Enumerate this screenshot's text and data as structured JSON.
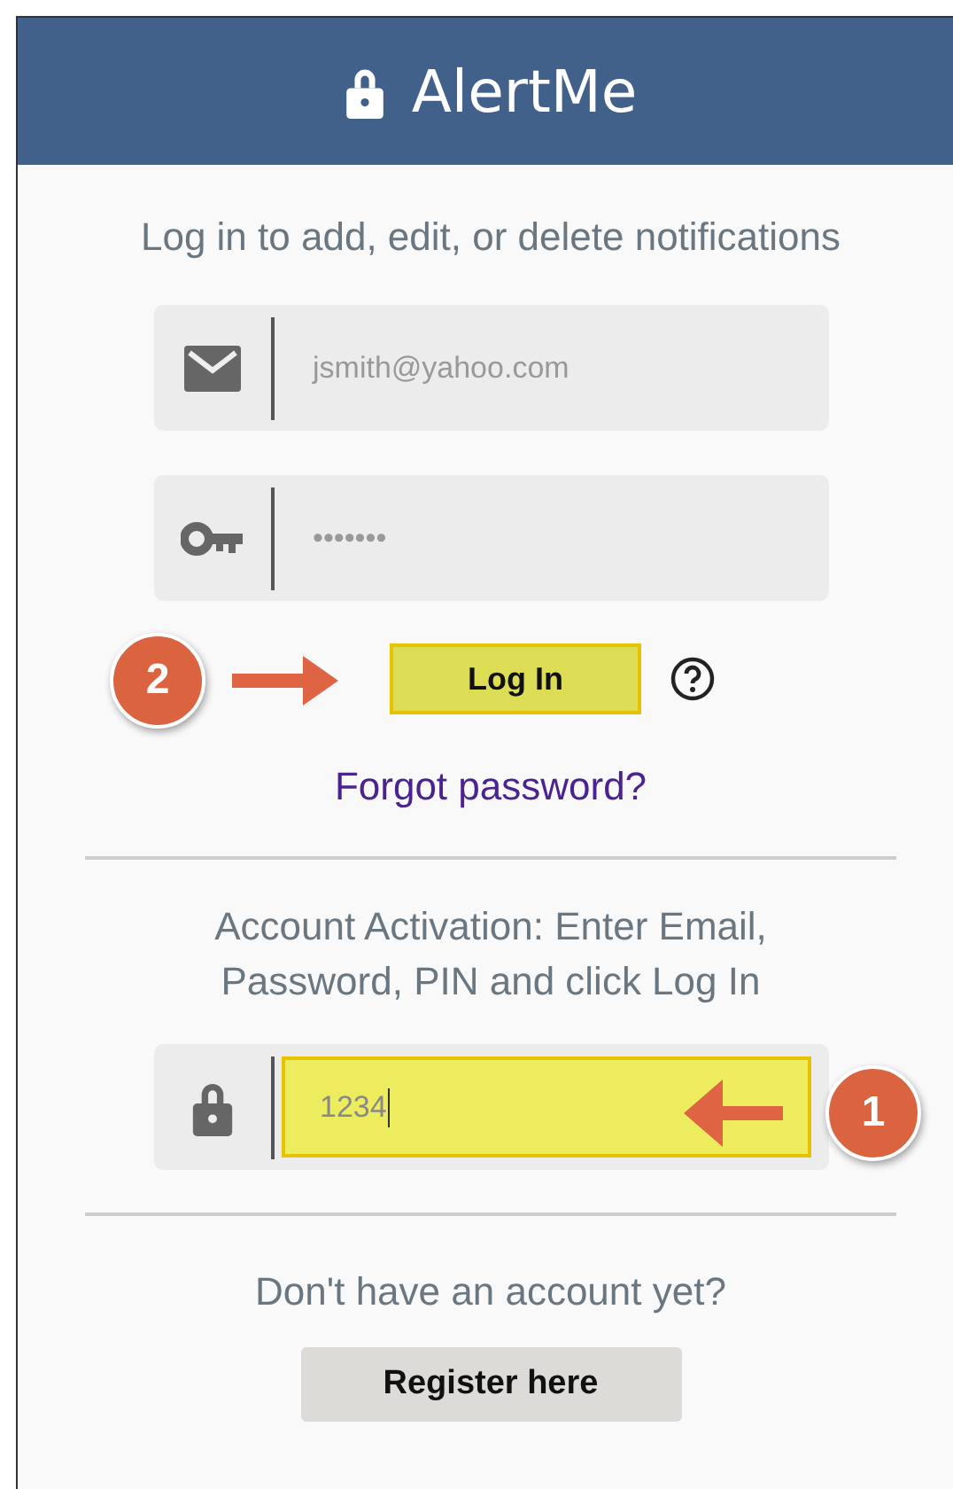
{
  "header": {
    "title": "AlertMe"
  },
  "subtitle": "Log in to add, edit, or delete notifications",
  "login_fields": [
    {
      "kind": "email",
      "value": "jsmith@yahoo.com",
      "highlighted": false
    },
    {
      "kind": "password",
      "value": "•••••••",
      "highlighted": false
    }
  ],
  "login_button": {
    "label": "Log In",
    "highlighted": true
  },
  "forgot_link": "Forgot password?",
  "activation": {
    "instructions": "Account Activation: Enter Email, Password, PIN and click Log In",
    "pin_field": {
      "value": "1234",
      "highlighted": true
    }
  },
  "register": {
    "prompt": "Don't have an account yet?",
    "button": "Register here"
  },
  "callouts": [
    {
      "label": "2",
      "kind": "login"
    },
    {
      "label": "1",
      "kind": "pin"
    }
  ]
}
